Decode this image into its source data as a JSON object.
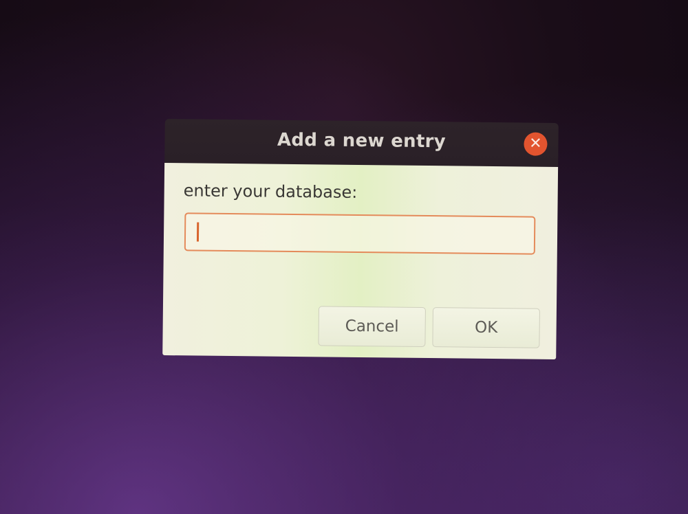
{
  "dialog": {
    "title": "Add a new entry",
    "close_icon": "close-icon",
    "close_glyph": "✕",
    "prompt": "enter your database:",
    "entry_value": "",
    "buttons": {
      "cancel_label": "Cancel",
      "ok_label": "OK"
    }
  },
  "colors": {
    "titlebar": "#2d2329",
    "close_button": "#e2542f",
    "entry_focus_border": "#e48a5a",
    "dialog_background": "#eef2d8"
  }
}
